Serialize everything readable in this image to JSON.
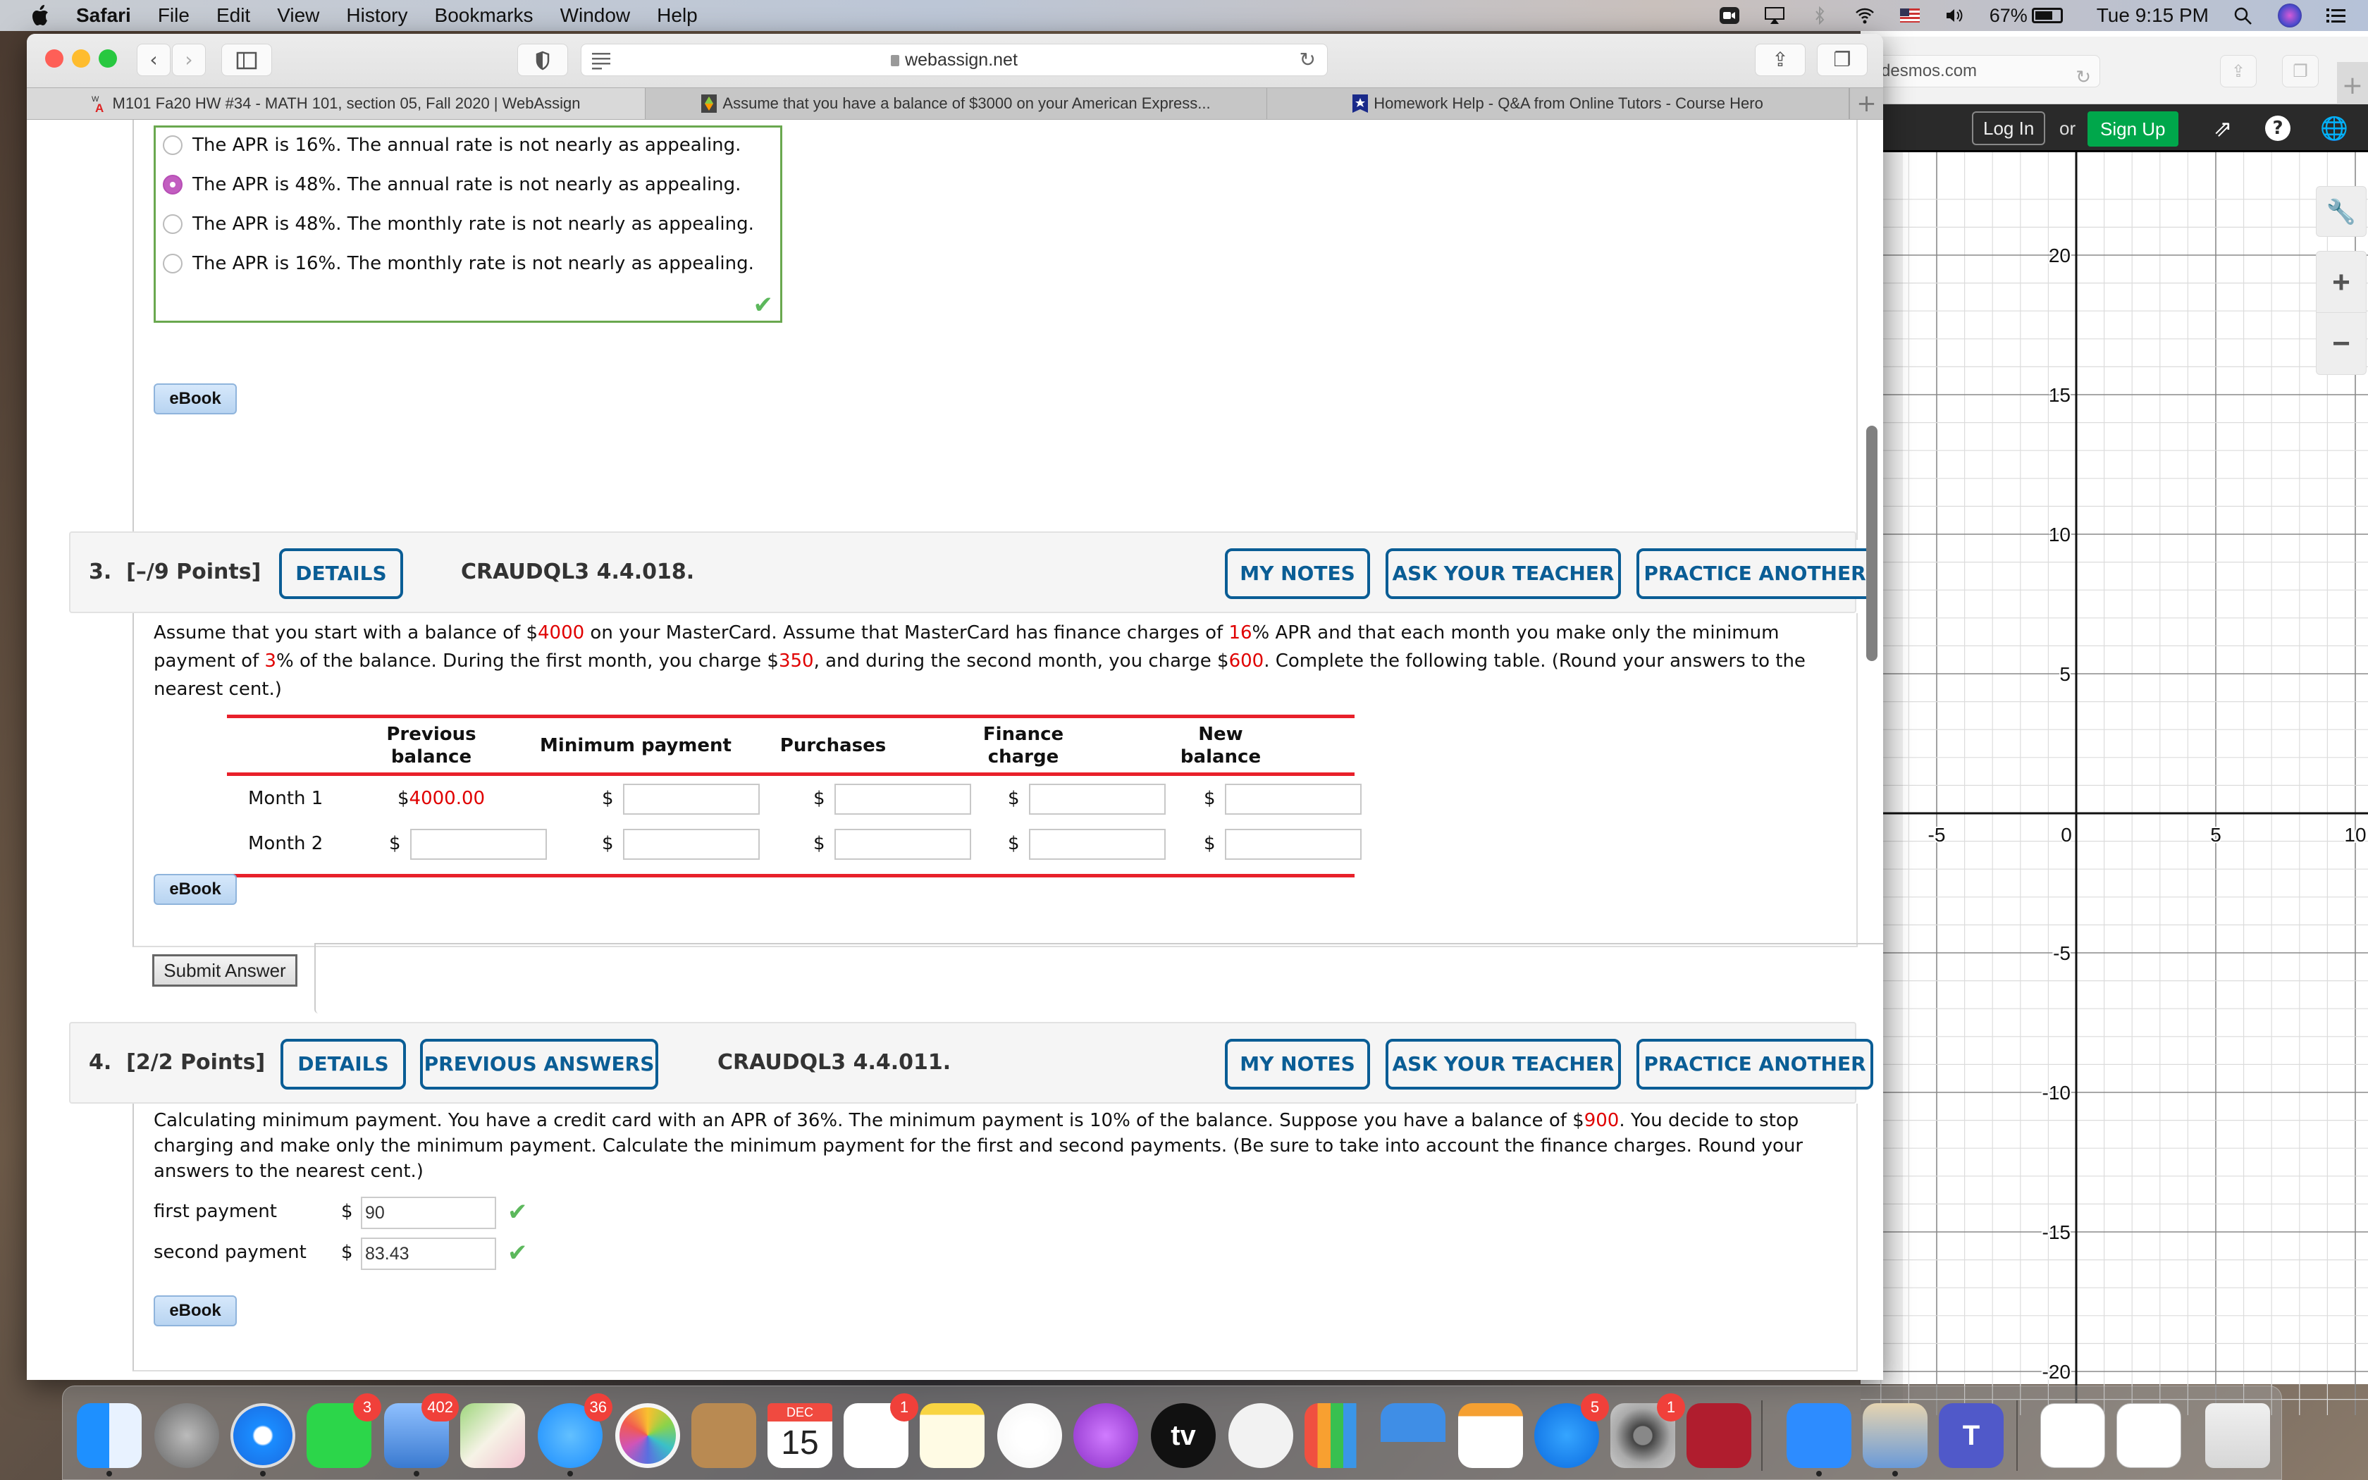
{
  "menubar": {
    "app_name": "Safari",
    "items": [
      "File",
      "Edit",
      "View",
      "History",
      "Bookmarks",
      "Window",
      "Help"
    ],
    "battery_percent": "67%",
    "battery_level": 0.67,
    "clock": "Tue 9:15 PM"
  },
  "desmos": {
    "url": "desmos.com",
    "login_label": "Log In",
    "or_label": "or",
    "signup_label": "Sign Up",
    "graph": {
      "x_ticks": [
        "-5",
        "0",
        "5",
        "10"
      ],
      "x_tick_values": [
        -5,
        0,
        5,
        10
      ],
      "y_ticks": [
        "20",
        "15",
        "10",
        "5",
        "-5",
        "-10",
        "-15",
        "-20"
      ],
      "y_tick_values": [
        20,
        15,
        10,
        5,
        -5,
        -10,
        -15,
        -20
      ],
      "x_range": [
        -7.6,
        10.4
      ],
      "y_range": [
        -22,
        22
      ]
    },
    "tools": {
      "wrench": "wrench-icon",
      "zoom_in": "+",
      "zoom_out": "−"
    }
  },
  "safari": {
    "url": "webassign.net",
    "tabs": [
      {
        "label": "M101 Fa20 HW #34 - MATH 101, section 05, Fall 2020 | WebAssign",
        "active": true
      },
      {
        "label": "Assume that you have a balance of $3000 on your American Express...",
        "active": false
      },
      {
        "label": "Homework Help - Q&A from Online Tutors - Course Hero",
        "active": false
      }
    ],
    "new_tab_label": "+"
  },
  "question2": {
    "options": [
      {
        "label": "The APR is 16%. The annual rate is not nearly as appealing.",
        "checked": false
      },
      {
        "label": "The APR is 48%. The annual rate is not nearly as appealing.",
        "checked": true
      },
      {
        "label": "The APR is 48%. The monthly rate is not nearly as appealing.",
        "checked": false
      },
      {
        "label": "The APR is 16%. The monthly rate is not nearly as appealing.",
        "checked": false
      }
    ],
    "status": "correct",
    "ebook_label": "eBook"
  },
  "question3": {
    "number": "3.",
    "points": "[–/9 Points]",
    "details_label": "DETAILS",
    "code": "CRAUDQL3 4.4.018.",
    "my_notes_label": "MY NOTES",
    "ask_teacher_label": "ASK YOUR TEACHER",
    "practice_label": "PRACTICE ANOTHER",
    "text_parts": {
      "p1": "Assume that you start with a balance of $",
      "v1": "4000",
      "p2": " on your MasterCard. Assume that MasterCard has finance charges of ",
      "v2": "16",
      "p3": "% APR and that each month you make only the minimum payment of ",
      "v3": "3",
      "p4": "% of the balance. During the first month, you charge $",
      "v4": "350",
      "p5": ", and during the second month, you charge $",
      "v5": "600",
      "p6": ". Complete the following table. (Round your answers to the nearest cent.)"
    },
    "table": {
      "headers": [
        "Previous balance",
        "Minimum payment",
        "Purchases",
        "Finance charge",
        "New balance"
      ],
      "header_lines": [
        [
          "Previous",
          "balance"
        ],
        [
          "Minimum payment"
        ],
        [
          "Purchases"
        ],
        [
          "Finance",
          "charge"
        ],
        [
          "New",
          "balance"
        ]
      ],
      "currency": "$",
      "rows": [
        {
          "label": "Month 1",
          "previous_balance": "4000.00",
          "minimum_payment": "",
          "purchases": "",
          "finance_charge": "",
          "new_balance": ""
        },
        {
          "label": "Month 2",
          "previous_balance": "",
          "minimum_payment": "",
          "purchases": "",
          "finance_charge": "",
          "new_balance": ""
        }
      ]
    },
    "ebook_label": "eBook",
    "submit_label": "Submit Answer"
  },
  "question4": {
    "number": "4.",
    "points": "[2/2 Points]",
    "details_label": "DETAILS",
    "previous_answers_label": "PREVIOUS ANSWERS",
    "code": "CRAUDQL3 4.4.011.",
    "my_notes_label": "MY NOTES",
    "ask_teacher_label": "ASK YOUR TEACHER",
    "practice_label": "PRACTICE ANOTHER",
    "text_parts": {
      "p1": "Calculating minimum payment. You have a credit card with an APR of 36%. The minimum payment is 10% of the balance. Suppose you have a balance of $",
      "v1": "900",
      "p2": ". You decide to stop charging and make only the minimum payment. Calculate the minimum payment for the first and second payments. (Be sure to take into account the finance charges. Round your answers to the nearest cent.)"
    },
    "answers": [
      {
        "label": "first payment",
        "currency": "$",
        "value": "90",
        "status": "correct"
      },
      {
        "label": "second payment",
        "currency": "$",
        "value": "83.43",
        "status": "correct"
      }
    ],
    "ebook_label": "eBook"
  },
  "dock": {
    "apps": [
      {
        "name": "Finder",
        "badge": null,
        "running": true
      },
      {
        "name": "Launchpad",
        "badge": null,
        "running": false
      },
      {
        "name": "Safari",
        "badge": null,
        "running": true
      },
      {
        "name": "FaceTime",
        "badge": "3",
        "running": false
      },
      {
        "name": "Mail",
        "badge": "402",
        "running": true
      },
      {
        "name": "Maps",
        "badge": null,
        "running": false
      },
      {
        "name": "Messages",
        "badge": "36",
        "running": true
      },
      {
        "name": "Photos",
        "badge": null,
        "running": false
      },
      {
        "name": "Contacts",
        "badge": null,
        "running": false
      },
      {
        "name": "Calendar",
        "badge": null,
        "running": false,
        "month": "DEC",
        "day": "15"
      },
      {
        "name": "Reminders",
        "badge": "1",
        "running": false
      },
      {
        "name": "Notes",
        "badge": null,
        "running": false
      },
      {
        "name": "Music",
        "badge": null,
        "running": false
      },
      {
        "name": "Podcasts",
        "badge": null,
        "running": false
      },
      {
        "name": "TV",
        "badge": null,
        "running": false,
        "glyph": "tv"
      },
      {
        "name": "News",
        "badge": null,
        "running": false
      },
      {
        "name": "Numbers",
        "badge": null,
        "running": false
      },
      {
        "name": "Keynote",
        "badge": null,
        "running": false
      },
      {
        "name": "Pages",
        "badge": null,
        "running": false
      },
      {
        "name": "App Store",
        "badge": "5",
        "running": false
      },
      {
        "name": "System Preferences",
        "badge": "1",
        "running": false
      },
      {
        "name": "Photo Booth",
        "badge": null,
        "running": false
      },
      {
        "name": "Zoom",
        "badge": null,
        "running": true
      },
      {
        "name": "Preview",
        "badge": null,
        "running": true
      },
      {
        "name": "Teams",
        "badge": null,
        "running": false,
        "glyph": "T"
      },
      {
        "name": "Document Stack 1",
        "badge": null,
        "running": false
      },
      {
        "name": "Document Stack 2",
        "badge": null,
        "running": false
      },
      {
        "name": "Trash",
        "badge": null,
        "running": false
      }
    ]
  }
}
